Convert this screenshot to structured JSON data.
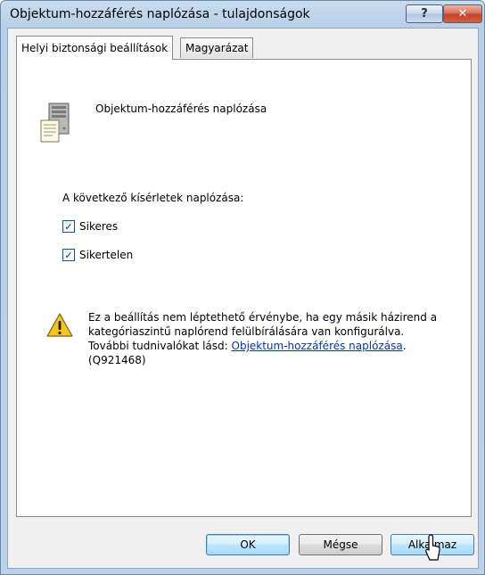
{
  "window": {
    "title": "Objektum-hozzáférés naplózása - tulajdonságok",
    "help_label": "?",
    "close_label": "✕"
  },
  "tabs": [
    {
      "label": "Helyi biztonsági beállítások",
      "active": true
    },
    {
      "label": "Magyarázat",
      "active": false
    }
  ],
  "policy": {
    "name": "Objektum-hozzáférés naplózása",
    "icon": "server-icon"
  },
  "audit": {
    "label": "A következő kísérletek naplózása:",
    "options": [
      {
        "label": "Sikeres",
        "checked": true
      },
      {
        "label": "Sikertelen",
        "checked": true
      }
    ]
  },
  "warning": {
    "icon": "warning-icon",
    "line1": "Ez a beállítás nem léptethető érvénybe, ha egy másik házirend a",
    "line2": "kategóriaszintű naplórend felülbírálására van konfigurálva.",
    "line3_prefix": "További tudnivalókat lásd: ",
    "link": "Objektum-hozzáférés naplózása",
    "line3_suffix": ".",
    "line4": "(Q921468)"
  },
  "buttons": {
    "ok": "OK",
    "cancel": "Mégse",
    "apply": "Alkalmaz"
  }
}
